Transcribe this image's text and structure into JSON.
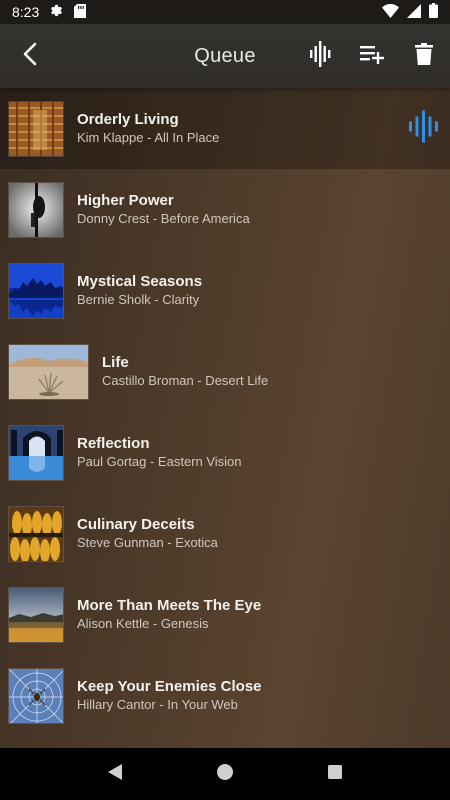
{
  "status_bar": {
    "time": "8:23",
    "icons": [
      "gear-icon",
      "sd-card-icon",
      "wifi-icon",
      "signal-icon",
      "battery-icon"
    ]
  },
  "toolbar": {
    "title": "Queue",
    "back_icon": "back-arrow-icon",
    "actions": [
      "now-playing-icon",
      "playlist-add-icon",
      "trash-icon"
    ]
  },
  "queue": [
    {
      "title": "Orderly Living",
      "subtitle": "Kim Klappe - All In Place",
      "active": true
    },
    {
      "title": "Higher Power",
      "subtitle": "Donny Crest - Before America"
    },
    {
      "title": "Mystical Seasons",
      "subtitle": "Bernie Sholk - Clarity"
    },
    {
      "title": "Life",
      "subtitle": "Castillo Broman - Desert Life"
    },
    {
      "title": "Reflection",
      "subtitle": "Paul Gortag - Eastern Vision"
    },
    {
      "title": "Culinary Deceits",
      "subtitle": "Steve Gunman - Exotica"
    },
    {
      "title": "More Than Meets The Eye",
      "subtitle": "Alison Kettle - Genesis"
    },
    {
      "title": "Keep Your Enemies Close",
      "subtitle": "Hillary Cantor - In Your Web"
    }
  ],
  "colors": {
    "accent": "#2f8ee8",
    "toolbar_bg": "#33302d",
    "background": "#4a3828"
  },
  "nav_bar": [
    "back-triangle-icon",
    "home-circle-icon",
    "recents-square-icon"
  ]
}
